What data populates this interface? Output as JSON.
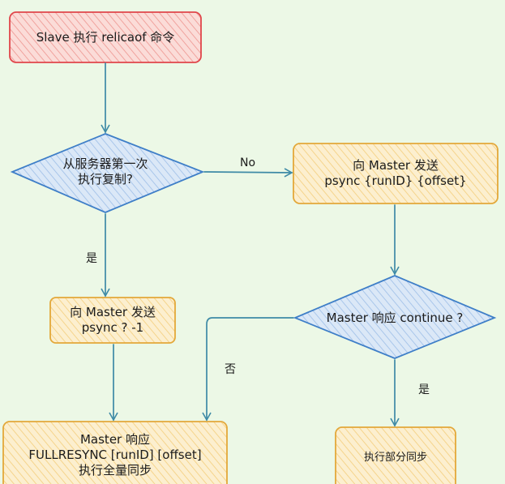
{
  "nodes": {
    "start": {
      "label": "Slave 执行 relicaof 命令",
      "fill": "#f7c6c2",
      "stroke": "#e0464b"
    },
    "first_check": {
      "label": "从服务器第一次\n执行复制?",
      "fill": "#c7dbf2",
      "stroke": "#3f7fc8"
    },
    "psync_full": {
      "label": "向 Master 发送\npsync ? -1",
      "fill": "#fbe6b8",
      "stroke": "#e3a83a"
    },
    "psync_partial": {
      "label": "向 Master 发送\npsync {runID} {offset}",
      "fill": "#fbe6b8",
      "stroke": "#e3a83a"
    },
    "continue_check": {
      "label": "Master 响应 continue ?",
      "fill": "#c7dbf2",
      "stroke": "#3f7fc8"
    },
    "fullresync": {
      "label": "Master 响应\nFULLRESYNC [runID] [offset]\n执行全量同步",
      "fill": "#fbe6b8",
      "stroke": "#e3a83a"
    },
    "partial_sync": {
      "label": "执行部分同步",
      "fill": "#fbe6b8",
      "stroke": "#e3a83a"
    }
  },
  "edges": {
    "no": "No",
    "yes_first": "是",
    "no_continue": "否",
    "yes_continue": "是"
  },
  "colors": {
    "background": "#ecf8e6",
    "arrow": "#3e8aa6"
  }
}
